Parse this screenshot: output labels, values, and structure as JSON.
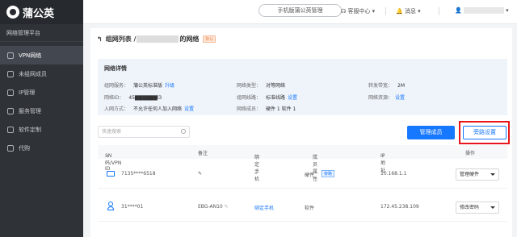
{
  "sidebar": {
    "logo": "蒲公英",
    "platform": "网络管理平台",
    "items": [
      {
        "label": "VPN网络",
        "active": true,
        "icon": "vpn-icon"
      },
      {
        "label": "未组网成员",
        "active": false,
        "icon": "member-icon"
      },
      {
        "label": "IP管理",
        "active": false,
        "icon": "ip-icon"
      },
      {
        "label": "服务管理",
        "active": false,
        "icon": "service-icon"
      },
      {
        "label": "软件定制",
        "active": false,
        "icon": "software-icon"
      },
      {
        "label": "代购",
        "active": false,
        "icon": "purchase-icon"
      }
    ]
  },
  "topbar": {
    "mobile_btn": "手机版蒲公英管理",
    "help": "客服中心",
    "messages": "消息",
    "account": ""
  },
  "page": {
    "breadcrumb_parent": "组网列表 /",
    "title_suffix": "的网络",
    "badge": "默认"
  },
  "details": {
    "title": "网络详情",
    "items": [
      {
        "label": "组网服务：",
        "value": "蒲公英标准版",
        "link": "升级"
      },
      {
        "label": "网络类型：",
        "value": "对等网络",
        "link": ""
      },
      {
        "label": "转发带宽：",
        "value": "2M",
        "link": ""
      },
      {
        "label": "网络ID：",
        "value": "45▇▇▇▇▇▇l3",
        "link": ""
      },
      {
        "label": "组网线路：",
        "value": "标准线路",
        "link": "设置"
      },
      {
        "label": "网络资源：",
        "value": "",
        "link": "设置"
      },
      {
        "label": "入网方式：",
        "value": "不允许任何人加入网络",
        "link": "设置"
      },
      {
        "label": "网络成员：",
        "value": "硬件 1   软件 1",
        "link": ""
      }
    ]
  },
  "toolbar": {
    "search_placeholder": "快速搜索",
    "manage_members": "管理成员",
    "bypass_settings": "旁路设置"
  },
  "table": {
    "headers": [
      "SN码/VPN ID",
      "备注",
      "绑定手机",
      "成员属性",
      "IP地址",
      "操作"
    ],
    "rows": [
      {
        "id": "7135****6518",
        "note": "",
        "phone": "-",
        "attr": "硬件",
        "tag": "旁路",
        "ip": "10.168.1.1",
        "action": "管理硬件"
      },
      {
        "id": "31****01",
        "note": "EBG-AN10",
        "phone": "绑定手机",
        "attr": "软件",
        "tag": "",
        "ip": "172.45.238.109",
        "action": "修改密码"
      }
    ]
  }
}
